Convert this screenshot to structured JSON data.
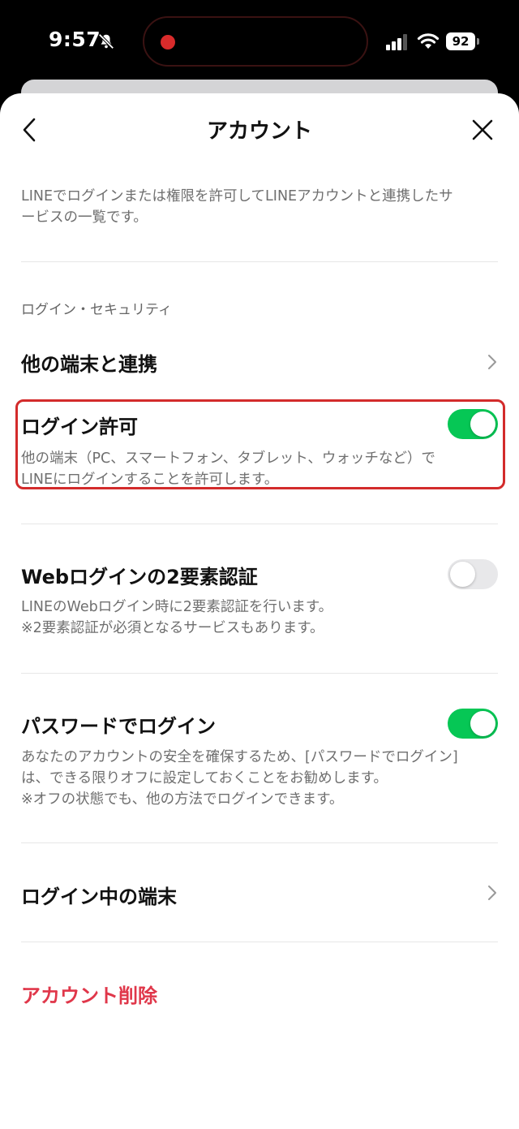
{
  "status_bar": {
    "time": "9:57",
    "battery": "92",
    "icons": [
      "bell-slash-icon",
      "signal-icon",
      "wifi-icon",
      "battery-icon"
    ],
    "recording_color": "#d92b2b"
  },
  "header": {
    "title": "アカウント",
    "back_icon": "chevron-left-icon",
    "close_icon": "close-icon"
  },
  "intro": {
    "line1": "LINEでログインまたは権限を許可してLINEアカウントと連携したサ",
    "line2": "ービスの一覧です。"
  },
  "section": {
    "label": "ログイン・セキュリティ"
  },
  "rows": {
    "link_devices": {
      "title": "他の端末と連携"
    },
    "login_permission": {
      "title": "ログイン許可",
      "toggle": true,
      "desc_line1": "他の端末（PC、スマートフォン、タブレット、ウォッチなど）で",
      "desc_line2": "LINEにログインすることを許可します。"
    },
    "web_2fa": {
      "title": "Webログインの2要素認証",
      "toggle": false,
      "desc_line1": "LINEのWebログイン時に2要素認証を行います。",
      "desc_line2": "※2要素認証が必須となるサービスもあります。"
    },
    "password_login": {
      "title": "パスワードでログイン",
      "toggle": true,
      "desc_line1": "あなたのアカウントの安全を確保するため、[パスワードでログイン]",
      "desc_line2": "は、できる限りオフに設定しておくことをお勧めします。",
      "desc_line3": "※オフの状態でも、他の方法でログインできます。"
    },
    "logged_in_devices": {
      "title": "ログイン中の端末"
    }
  },
  "delete_account": {
    "label": "アカウント削除"
  },
  "colors": {
    "toggle_on": "#06c755",
    "danger": "#e0374a",
    "highlight_border": "#d32b2b"
  }
}
